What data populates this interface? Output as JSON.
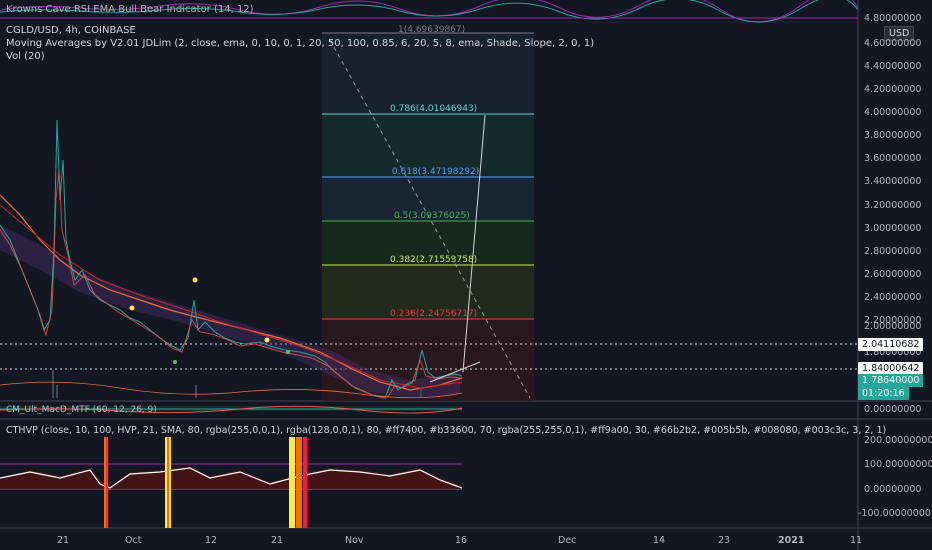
{
  "top_indicator": {
    "label": "Krowns Cave RSI EMA Bull Bear Indicator (14, 12)"
  },
  "symbol": {
    "title": "CGLD/USD, 4h, COINBASE"
  },
  "indicators": {
    "ma": "Moving Averages by V2.01 JDLim (2, close, ema, 0, 10, 0, 1, 20, 50, 100, 0.85, 6, 20, 5, 8, ema, Shade, Slope, 2, 0, 1)",
    "vol": "Vol (20)",
    "macd": "CM_Ult_MacD_MTF (60, 12, 26, 9)",
    "cthvp": "CTHVP (close, 10, 100, HVP, 21, SMA, 80, rgba(255,0,0,1), rgba(128,0,0,1), 80, #ff7400, #b33600, 70, rgba(255,255,0,1), #ff9a00, 30, #66b2b2, #005b5b, #008080, #003c3c, 3, 2, 1)"
  },
  "currency_badge": "USD",
  "price_axis": [
    "4.80000000",
    "4.60000000",
    "4.40000000",
    "4.20000000",
    "4.00000000",
    "3.80000000",
    "3.60000000",
    "3.40000000",
    "3.20000000",
    "3.00000000",
    "2.80000000",
    "2.60000000",
    "2.40000000",
    "2.20000000",
    "2.00000000",
    "1.80000000",
    "1"
  ],
  "price_tags": {
    "level_a": "2.04110682",
    "level_b": "1.84000642",
    "current_price": "1.78640000",
    "countdown": "01:20:16"
  },
  "macd_axis": [
    "0.00000000"
  ],
  "cthvp_axis": [
    "200.00000000",
    "100.00000000",
    "0.00000000",
    "-100.00000000"
  ],
  "fib_levels": [
    {
      "label": "1(4.69639867)",
      "color": "#787b86"
    },
    {
      "label": "0.786(4.01046943)",
      "color": "#5dd5d5"
    },
    {
      "label": "0.618(3.47198292)",
      "color": "#5b9cf6"
    },
    {
      "label": "0.5(3.09376025)",
      "color": "#4caf50"
    },
    {
      "label": "0.382(2.71553758)",
      "color": "#d4e157"
    },
    {
      "label": "0.236(2.24756717)",
      "color": "#f23645"
    }
  ],
  "time_axis": [
    "21",
    "Oct",
    "12",
    "21",
    "Nov",
    "16",
    "Dec",
    "14",
    "23",
    "2021",
    "11"
  ],
  "colors": {
    "background": "#131722",
    "up": "#26a69a",
    "down": "#ef5350",
    "accent": "#2962ff"
  }
}
